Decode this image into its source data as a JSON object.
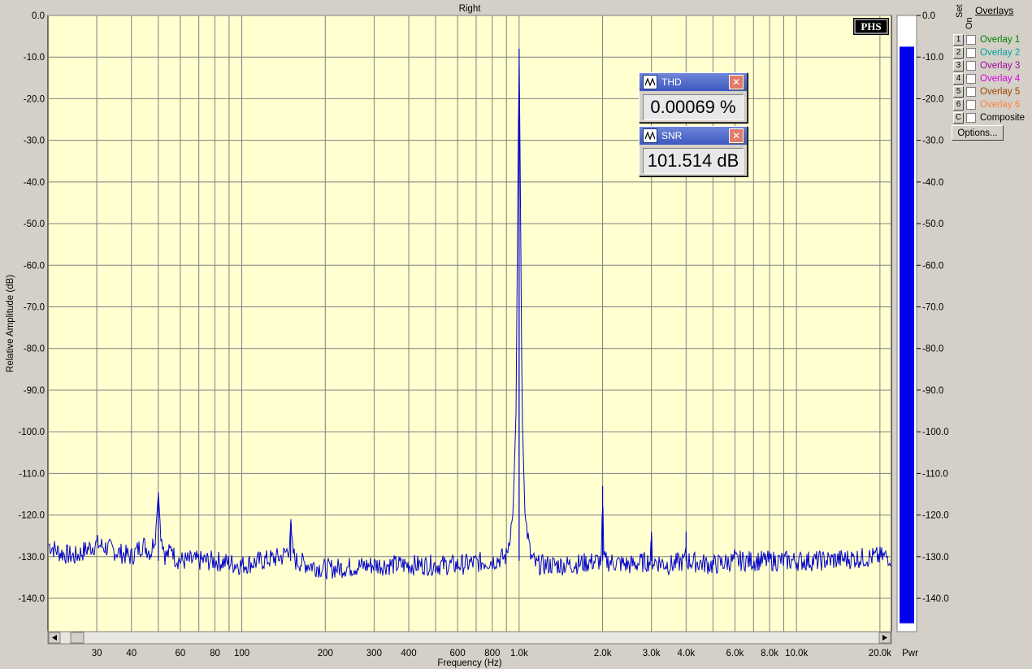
{
  "window": {
    "title": "Right"
  },
  "chart_data": {
    "type": "line",
    "title": "Right",
    "xlabel": "Frequency (Hz)",
    "ylabel": "Relative Amplitude (dB)",
    "xscale": "log",
    "xlim": [
      20,
      22000
    ],
    "ylim": [
      -148,
      0
    ],
    "x_ticks": [
      30,
      40,
      60,
      80,
      100,
      200,
      300,
      400,
      600,
      800,
      1000,
      2000,
      3000,
      4000,
      6000,
      8000,
      10000,
      20000
    ],
    "x_tick_labels": [
      "30",
      "40",
      "60",
      "80",
      "100",
      "200",
      "300",
      "400",
      "600",
      "800",
      "1.0k",
      "2.0k",
      "3.0k",
      "4.0k",
      "6.0k",
      "8.0k",
      "10.0k",
      "20.0k"
    ],
    "y_ticks": [
      0,
      -10,
      -20,
      -30,
      -40,
      -50,
      -60,
      -70,
      -80,
      -90,
      -100,
      -110,
      -120,
      -130,
      -140
    ],
    "y_tick_labels": [
      "0.0",
      "-10.0",
      "-20.0",
      "-30.0",
      "-40.0",
      "-50.0",
      "-60.0",
      "-70.0",
      "-80.0",
      "-90.0",
      "-100.0",
      "-110.0",
      "-120.0",
      "-130.0",
      "-140.0"
    ],
    "grid": true,
    "series": [
      {
        "color": "#0000cc",
        "noise_floor_db": -131,
        "points": [
          [
            20,
            -127
          ],
          [
            22,
            -129
          ],
          [
            25,
            -130
          ],
          [
            28,
            -128
          ],
          [
            30,
            -127
          ],
          [
            33,
            -128
          ],
          [
            36,
            -129
          ],
          [
            40,
            -130
          ],
          [
            44,
            -127
          ],
          [
            47,
            -129
          ],
          [
            49,
            -124
          ],
          [
            50,
            -114.5
          ],
          [
            51,
            -124
          ],
          [
            53,
            -130
          ],
          [
            55,
            -129
          ],
          [
            56,
            -127
          ],
          [
            57,
            -130
          ],
          [
            60,
            -131
          ],
          [
            80,
            -131
          ],
          [
            100,
            -132
          ],
          [
            140,
            -130
          ],
          [
            148,
            -128
          ],
          [
            150,
            -122
          ],
          [
            152,
            -128
          ],
          [
            156,
            -131
          ],
          [
            200,
            -133
          ],
          [
            300,
            -132
          ],
          [
            400,
            -132
          ],
          [
            600,
            -132
          ],
          [
            800,
            -131
          ],
          [
            900,
            -130
          ],
          [
            950,
            -120
          ],
          [
            975,
            -95
          ],
          [
            990,
            -40
          ],
          [
            1000,
            -8
          ],
          [
            1010,
            -40
          ],
          [
            1025,
            -95
          ],
          [
            1050,
            -120
          ],
          [
            1100,
            -130
          ],
          [
            1150,
            -132
          ],
          [
            1500,
            -132
          ],
          [
            1980,
            -131
          ],
          [
            2000,
            -113
          ],
          [
            2020,
            -131
          ],
          [
            2500,
            -132
          ],
          [
            2980,
            -131
          ],
          [
            3000,
            -124
          ],
          [
            3020,
            -131
          ],
          [
            3500,
            -132
          ],
          [
            3980,
            -131
          ],
          [
            4000,
            -124
          ],
          [
            4020,
            -131
          ],
          [
            5000,
            -132
          ],
          [
            5980,
            -131
          ],
          [
            6000,
            -127
          ],
          [
            6020,
            -131
          ],
          [
            8000,
            -131
          ],
          [
            12000,
            -131
          ],
          [
            20000,
            -130
          ],
          [
            22000,
            -130
          ]
        ]
      }
    ]
  },
  "power_meter": {
    "level_db": -7.5,
    "ticks": [
      "0.0",
      "-10.0",
      "-20.0",
      "-30.0",
      "-40.0",
      "-50.0",
      "-60.0",
      "-70.0",
      "-80.0",
      "-90.0",
      "-100.0",
      "-110.0",
      "-120.0",
      "-130.0",
      "-140.0"
    ],
    "label": "Pwr"
  },
  "logo": {
    "text": "PHS"
  },
  "thd": {
    "label": "THD",
    "value": "0.00069 %"
  },
  "snr": {
    "label": "SNR",
    "value": "101.514 dB"
  },
  "overlays": {
    "heading": "Overlays",
    "set_label": "Set",
    "on_label": "On",
    "items": [
      {
        "num": "1",
        "name": "Overlay 1",
        "color": "#008000"
      },
      {
        "num": "2",
        "name": "Overlay 2",
        "color": "#00a0a0"
      },
      {
        "num": "3",
        "name": "Overlay 3",
        "color": "#a000a0"
      },
      {
        "num": "4",
        "name": "Overlay 4",
        "color": "#e000e0"
      },
      {
        "num": "5",
        "name": "Overlay 5",
        "color": "#a04000"
      },
      {
        "num": "6",
        "name": "Overlay 6",
        "color": "#ff8040"
      },
      {
        "num": "C",
        "name": "Composite",
        "color": "#000000"
      }
    ],
    "options_label": "Options..."
  },
  "colors": {
    "plot_bg": "#ffffd0",
    "grid": "#808080",
    "trace": "#0000cc",
    "meter": "#0000ee"
  }
}
